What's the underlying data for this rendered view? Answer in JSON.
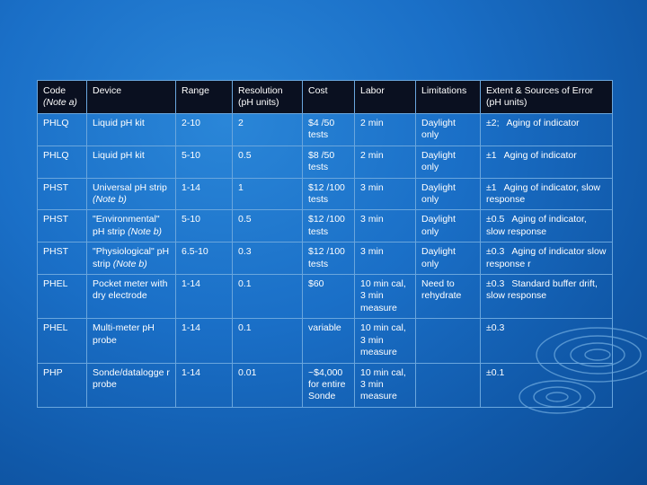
{
  "table": {
    "headers": {
      "code": "Code",
      "code_note": "(Note a)",
      "device": "Device",
      "range": "Range",
      "resolution": "Resolution (pH units)",
      "cost": "Cost",
      "labor": "Labor",
      "limitations": "Limitations",
      "extent": "Extent & Sources of Error (pH units)"
    },
    "rows": [
      {
        "code": "PHLQ",
        "device": "Liquid pH kit",
        "device_note": "",
        "range": "2-10",
        "resolution": "2",
        "cost": "$4 /50 tests",
        "labor": "2 min",
        "limitations": "Daylight only",
        "error_value": "±2;",
        "error_source": "Aging of indicator"
      },
      {
        "code": "PHLQ",
        "device": "Liquid pH kit",
        "device_note": "",
        "range": "5-10",
        "resolution": "0.5",
        "cost": "$8 /50 tests",
        "labor": "2 min",
        "limitations": "Daylight only",
        "error_value": "±1",
        "error_source": "Aging of indicator"
      },
      {
        "code": "PHST",
        "device": "Universal pH strip",
        "device_note": "(Note b)",
        "range": "1-14",
        "resolution": "1",
        "cost": "$12 /100 tests",
        "labor": "3 min",
        "limitations": "Daylight only",
        "error_value": "±1",
        "error_source": "Aging of indicator, slow response"
      },
      {
        "code": "PHST",
        "device": "\"Environmental\" pH strip",
        "device_note": "(Note b)",
        "range": "5-10",
        "resolution": "0.5",
        "cost": "$12 /100 tests",
        "labor": "3 min",
        "limitations": "Daylight only",
        "error_value": "±0.5",
        "error_source": "Aging of indicator, slow response"
      },
      {
        "code": "PHST",
        "device": "\"Physiological\" pH strip",
        "device_note": "(Note b)",
        "range": "6.5-10",
        "resolution": "0.3",
        "cost": "$12 /100 tests",
        "labor": "3 min",
        "limitations": "Daylight only",
        "error_value": "±0.3",
        "error_source": "Aging of indicator slow response r"
      },
      {
        "code": "PHEL",
        "device": "Pocket meter with dry electrode",
        "device_note": "",
        "range": "1-14",
        "resolution": "0.1",
        "cost": "$60",
        "labor": "10 min cal, 3 min measure",
        "limitations": "Need to rehydrate",
        "error_value": "±0.3",
        "error_source": "Standard buffer drift, slow response"
      },
      {
        "code": "PHEL",
        "device": "Multi-meter pH probe",
        "device_note": "",
        "range": "1-14",
        "resolution": "0.1",
        "cost": "variable",
        "labor": "10 min cal, 3 min measure",
        "limitations": "",
        "error_value": "±0.3",
        "error_source": ""
      },
      {
        "code": "PHP",
        "device": "Sonde/datalogge r probe",
        "device_note": "",
        "range": "1-14",
        "resolution": "0.01",
        "cost": "~$4,000 for entire Sonde",
        "labor": "10 min cal, 3 min measure",
        "limitations": "",
        "error_value": "±0.1",
        "error_source": ""
      }
    ]
  },
  "colors": {
    "background": "#1a6fc7",
    "header_background": "#0a1020",
    "grid_line": "#6aa6dd",
    "text": "#ffffff"
  }
}
